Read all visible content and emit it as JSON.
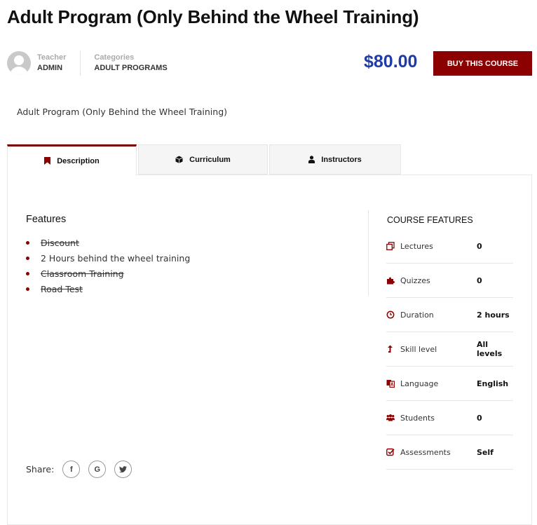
{
  "course": {
    "title": "Adult Program (Only Behind the Wheel Training)",
    "subtitle": "Adult Program (Only Behind the Wheel Training)"
  },
  "meta": {
    "teacher_label": "Teacher",
    "teacher_value": "ADMIN",
    "categories_label": "Categories",
    "categories_value": "ADULT PROGRAMS"
  },
  "purchase": {
    "price": "$80.00",
    "buy_label": "BUY THIS COURSE"
  },
  "tabs": [
    {
      "label": "Description",
      "icon": "bookmark-icon",
      "active": true
    },
    {
      "label": "Curriculum",
      "icon": "cube-icon",
      "active": false
    },
    {
      "label": "Instructors",
      "icon": "user-icon",
      "active": false
    }
  ],
  "features": {
    "heading": "Features",
    "items": [
      {
        "text": "Discount",
        "struck": true
      },
      {
        "text": "2 Hours behind the wheel training",
        "struck": false
      },
      {
        "text": "Classroom Training",
        "struck": true
      },
      {
        "text": "Road Test",
        "struck": true
      }
    ]
  },
  "course_features": {
    "heading": "COURSE FEATURES",
    "rows": [
      {
        "label": "Lectures",
        "value": "0",
        "icon": "files-icon"
      },
      {
        "label": "Quizzes",
        "value": "0",
        "icon": "puzzle-icon"
      },
      {
        "label": "Duration",
        "value": "2 hours",
        "icon": "clock-icon"
      },
      {
        "label": "Skill level",
        "value": "All levels",
        "icon": "level-up-icon"
      },
      {
        "label": "Language",
        "value": "English",
        "icon": "language-icon"
      },
      {
        "label": "Students",
        "value": "0",
        "icon": "users-icon"
      },
      {
        "label": "Assessments",
        "value": "Self",
        "icon": "check-square-icon"
      }
    ]
  },
  "share": {
    "label": "Share:",
    "buttons": [
      {
        "name": "facebook",
        "glyph": "f"
      },
      {
        "name": "google",
        "glyph": "G"
      },
      {
        "name": "twitter",
        "glyph": "t"
      }
    ]
  },
  "colors": {
    "accent": "#8b0000",
    "price": "#1f3ba8"
  }
}
